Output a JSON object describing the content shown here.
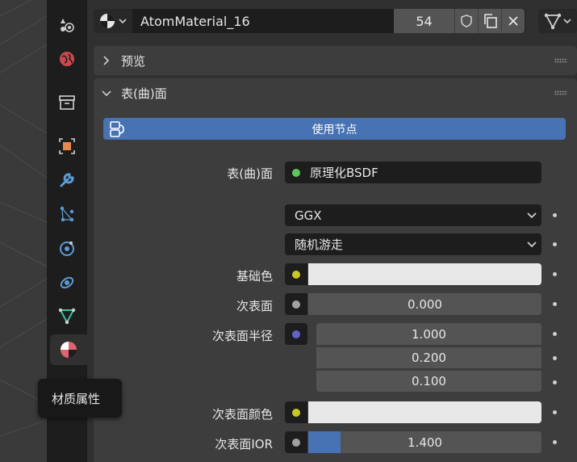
{
  "material": {
    "name": "AtomMaterial_16",
    "users": "54"
  },
  "panels": {
    "preview": "预览",
    "surface": "表(曲)面"
  },
  "use_nodes_label": "使用节点",
  "surface": {
    "label": "表(曲)面",
    "shader": "原理化BSDF",
    "shader_color": "#5cc85c",
    "distribution": "GGX",
    "subsurface_method": "随机游走"
  },
  "props": {
    "base_color_label": "基础色",
    "base_color_socket": "#c8c829",
    "subsurface_label": "次表面",
    "subsurface_value": "0.000",
    "subsurface_radius_label": "次表面半径",
    "subsurface_radius_socket": "#6363c7",
    "radius_x": "1.000",
    "radius_y": "0.200",
    "radius_z": "0.100",
    "subsurface_color_label": "次表面颜色",
    "subsurface_color_socket": "#c8c829",
    "subsurface_ior_label": "次表面IOR",
    "subsurface_ior_value": "1.400",
    "subsurface_ior_fill": 0.14
  },
  "tooltip": "材质属性",
  "colors": {
    "accent": "#4772b3",
    "material_tab_icon": "#e06372"
  }
}
